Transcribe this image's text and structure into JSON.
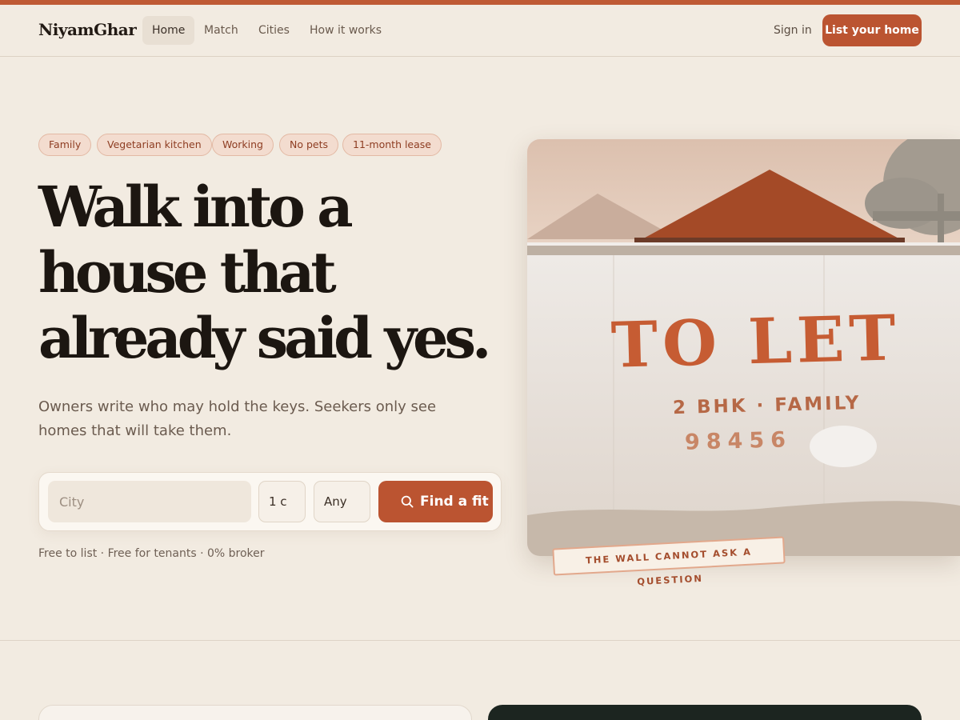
{
  "brand": {
    "name": "NiyamGhar",
    "accent": "#bb5431"
  },
  "nav": {
    "items": [
      {
        "label": "Home",
        "active": true
      },
      {
        "label": "Match"
      },
      {
        "label": "Cities"
      },
      {
        "label": "How it works"
      }
    ],
    "sign_in": "Sign in",
    "cta": "List your home"
  },
  "hero": {
    "chips": [
      "Family",
      "Vegetarian kitchen",
      "Working",
      "No pets",
      "11-month lease"
    ],
    "headline": [
      "Walk into a",
      "house that",
      "already said yes."
    ],
    "lede": "Owners write who may hold the keys. Seekers only see homes that will take them.",
    "search": {
      "city_placeholder": "City",
      "bhk_value": "1 c",
      "budget_value": "Any",
      "button_label": "Find a fit",
      "button_icon": "search-icon"
    },
    "fineprint": "Free to list · Free for tenants · 0% broker"
  },
  "sign": {
    "headline": "TO LET",
    "subline": "2 BHK · FAMILY",
    "phone": "98456",
    "caption": "THE WALL CANNOT ASK A QUESTION"
  }
}
